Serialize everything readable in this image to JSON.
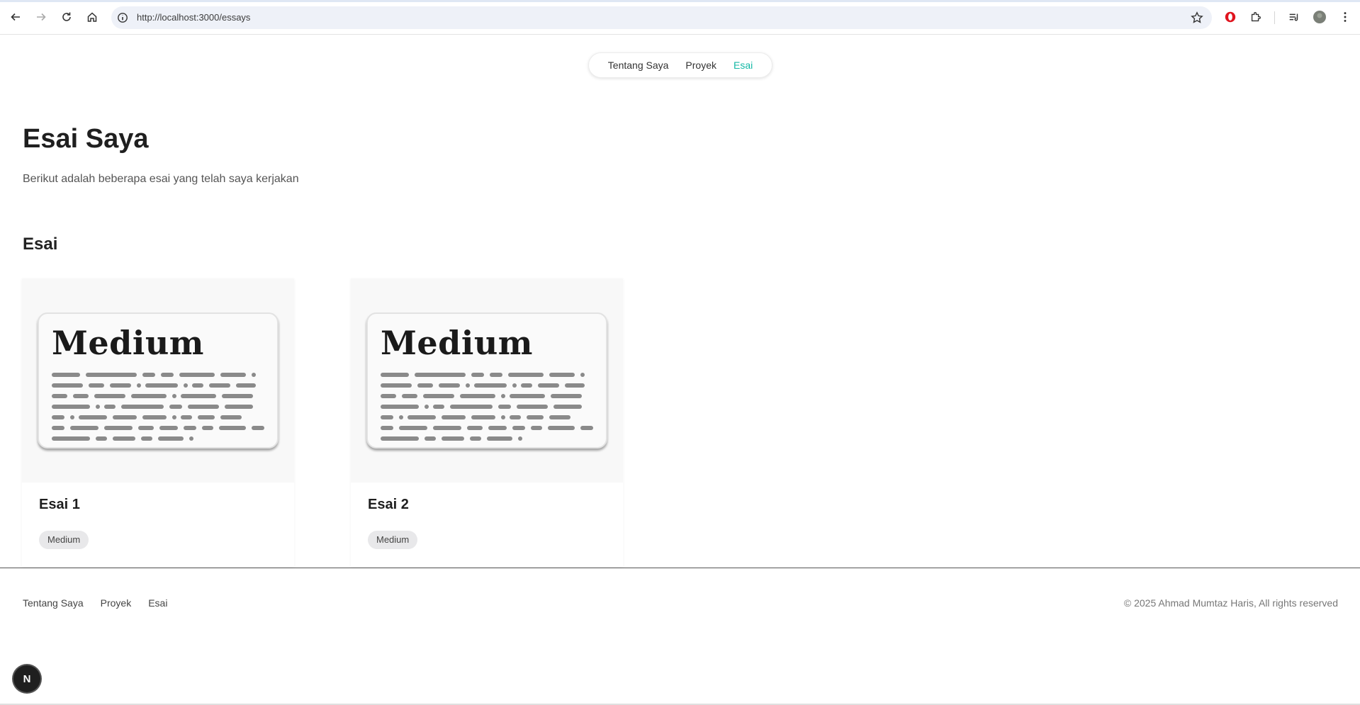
{
  "browser": {
    "url": "http://localhost:3000/essays"
  },
  "nav": {
    "items": [
      {
        "label": "Tentang Saya",
        "active": false
      },
      {
        "label": "Proyek",
        "active": false
      },
      {
        "label": "Esai",
        "active": true
      }
    ],
    "active_color": "#14b8a6"
  },
  "page": {
    "title": "Esai Saya",
    "description": "Berikut adalah beberapa esai yang telah saya kerjakan",
    "section_title": "Esai"
  },
  "essays": [
    {
      "title": "Esai 1",
      "thumbnail_text": "Medium",
      "tag": "Medium"
    },
    {
      "title": "Esai 2",
      "thumbnail_text": "Medium",
      "tag": "Medium"
    }
  ],
  "footer": {
    "links": [
      "Tentang Saya",
      "Proyek",
      "Esai"
    ],
    "copyright": "© 2025 Ahmad Mumtaz Haris, All rights reserved"
  },
  "dev_badge": {
    "label": "N"
  }
}
